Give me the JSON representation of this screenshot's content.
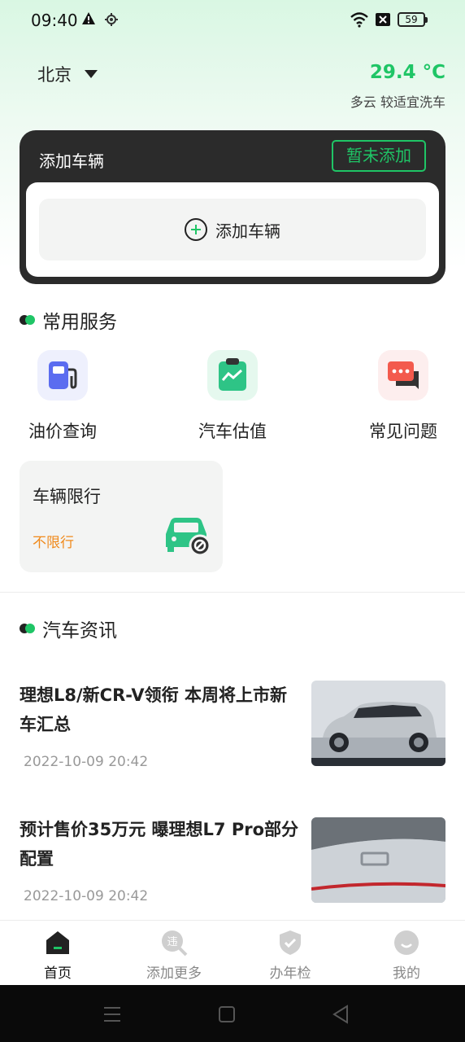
{
  "status_bar": {
    "time": "09:40",
    "battery": "59"
  },
  "header": {
    "city": "北京",
    "temperature": "29.4 °C",
    "weather": "多云 较适宜洗车"
  },
  "vehicle_card": {
    "title": "添加车辆",
    "badge": "暂未添加",
    "add_button": "添加车辆"
  },
  "services": {
    "heading": "常用服务",
    "items": [
      {
        "label": "油价查询",
        "icon": "fuel-pump-icon",
        "color": "#5b6cf0"
      },
      {
        "label": "汽车估值",
        "icon": "valuation-clipboard-icon",
        "color": "#2ec486"
      },
      {
        "label": "常见问题",
        "icon": "chat-bubble-icon",
        "color": "#f35a4d"
      }
    ],
    "restriction": {
      "title": "车辆限行",
      "status": "不限行"
    }
  },
  "news": {
    "heading": "汽车资讯",
    "items": [
      {
        "title": "理想L8/新CR-V领衔 本周将上市新车汇总",
        "time": "2022-10-09 20:42"
      },
      {
        "title": "预计售价35万元 曝理想L7 Pro部分配置",
        "time": "2022-10-09 20:42"
      }
    ]
  },
  "bottom_nav": [
    {
      "label": "首页",
      "active": true
    },
    {
      "label": "添加更多",
      "active": false
    },
    {
      "label": "办年检",
      "active": false
    },
    {
      "label": "我的",
      "active": false
    }
  ],
  "colors": {
    "accent": "#1fc566",
    "warning": "#f08a1c",
    "card_dark": "#2b2b2b"
  }
}
